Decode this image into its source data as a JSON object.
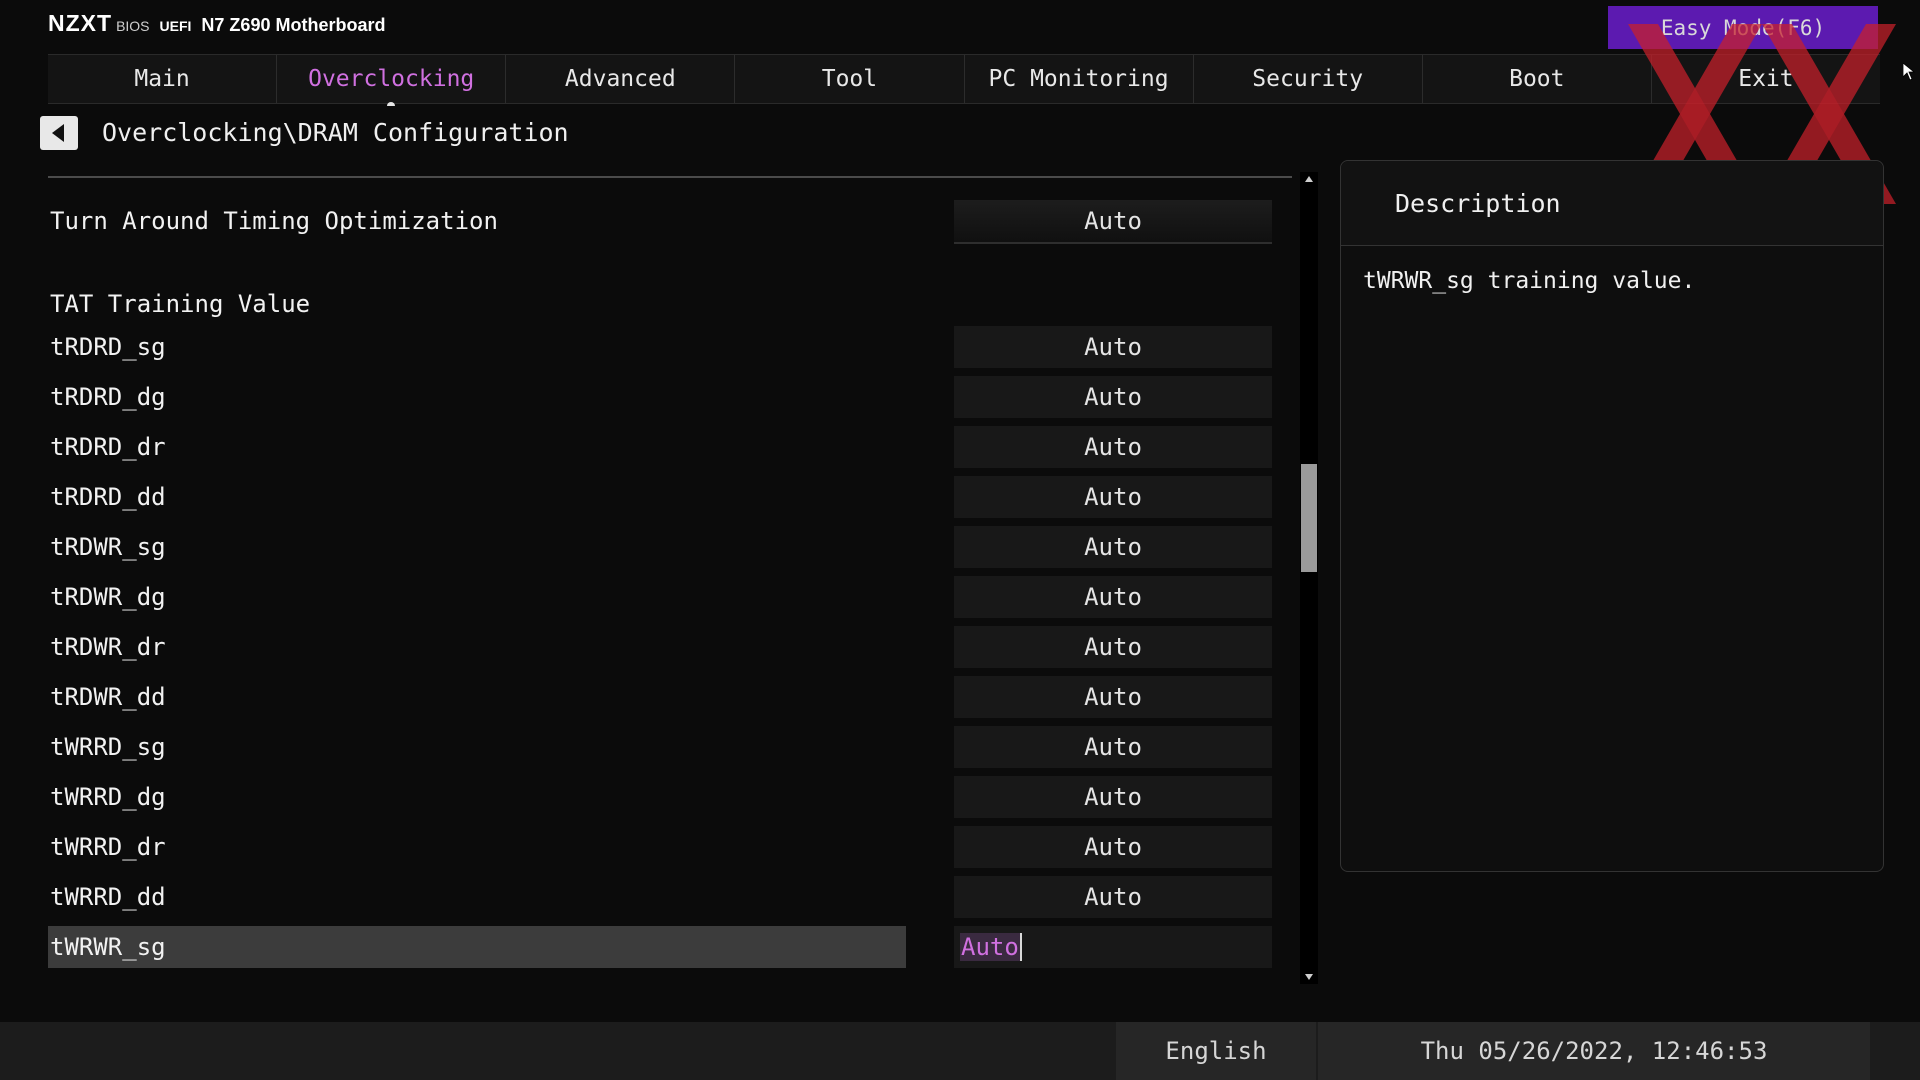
{
  "header": {
    "logo": "NZXT",
    "bios_label": "BIOS",
    "uefi_label": "UEFI",
    "model": "N7 Z690 Motherboard",
    "easy_mode_label": "Easy Mode(F6)"
  },
  "tabs": [
    {
      "label": "Main",
      "active": false
    },
    {
      "label": "Overclocking",
      "active": true
    },
    {
      "label": "Advanced",
      "active": false
    },
    {
      "label": "Tool",
      "active": false
    },
    {
      "label": "PC Monitoring",
      "active": false
    },
    {
      "label": "Security",
      "active": false
    },
    {
      "label": "Boot",
      "active": false
    },
    {
      "label": "Exit",
      "active": false
    }
  ],
  "breadcrumb": "Overclocking\\DRAM Configuration",
  "settings": {
    "turn_around": {
      "label": "Turn Around Timing Optimization",
      "value": "Auto"
    },
    "section_label": "TAT Training Value",
    "rows": [
      {
        "label": "tRDRD_sg",
        "value": "Auto"
      },
      {
        "label": "tRDRD_dg",
        "value": "Auto"
      },
      {
        "label": "tRDRD_dr",
        "value": "Auto"
      },
      {
        "label": "tRDRD_dd",
        "value": "Auto"
      },
      {
        "label": "tRDWR_sg",
        "value": "Auto"
      },
      {
        "label": "tRDWR_dg",
        "value": "Auto"
      },
      {
        "label": "tRDWR_dr",
        "value": "Auto"
      },
      {
        "label": "tRDWR_dd",
        "value": "Auto"
      },
      {
        "label": "tWRRD_sg",
        "value": "Auto"
      },
      {
        "label": "tWRRD_dg",
        "value": "Auto"
      },
      {
        "label": "tWRRD_dr",
        "value": "Auto"
      },
      {
        "label": "tWRRD_dd",
        "value": "Auto"
      },
      {
        "label": "tWRWR_sg",
        "value": "Auto"
      }
    ]
  },
  "description": {
    "title": "Description",
    "text": "tWRWR_sg training value."
  },
  "status": {
    "language": "English",
    "datetime": "Thu 05/26/2022, 12:46:53"
  },
  "colors": {
    "accent": "#d070e0",
    "easy_mode_bg": "#5c1ab0",
    "watermark": "#d32a2a"
  }
}
